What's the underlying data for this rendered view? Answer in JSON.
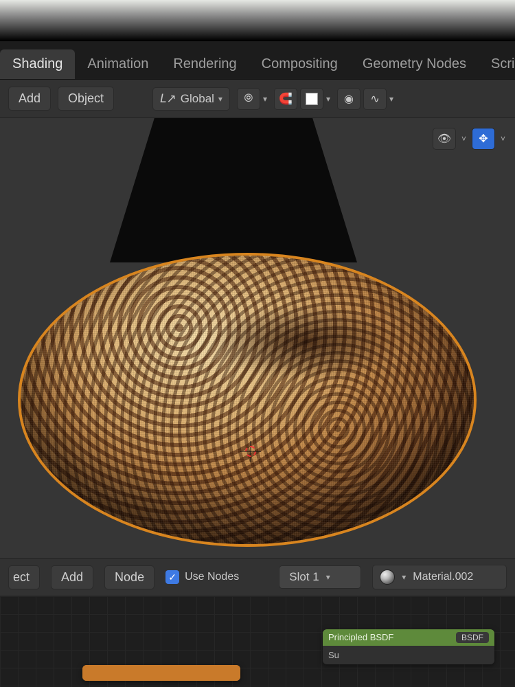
{
  "workspace_tabs": {
    "shading": "Shading",
    "animation": "Animation",
    "rendering": "Rendering",
    "compositing": "Compositing",
    "geonodes": "Geometry Nodes",
    "scripting": "Scripting",
    "add": "+"
  },
  "header": {
    "add": "Add",
    "object": "Object",
    "orientation": {
      "label": "Global"
    },
    "pivot_icon": "⦾",
    "snap_icon": "🧲",
    "prop_icon": "◉",
    "curve_icon": "∿"
  },
  "viewport": {
    "overlay_icon": "👁",
    "overlay_chev": "˅",
    "gizmo_icon": "✥"
  },
  "node_header": {
    "select": "ect",
    "add": "Add",
    "node": "Node",
    "use_nodes": "Use Nodes",
    "slot_label": "Slot 1",
    "material_name": "Material.002"
  },
  "nodes": {
    "principled": {
      "title": "Principled BSDF",
      "out": "BSDF"
    },
    "output": {
      "partial": "Su"
    }
  }
}
